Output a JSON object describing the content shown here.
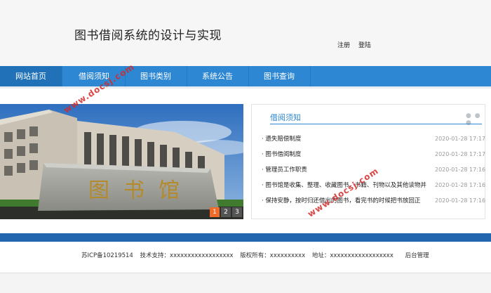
{
  "header": {
    "title": "图书借阅系统的设计与实现",
    "links": [
      "注册",
      "登陆"
    ]
  },
  "nav": {
    "items": [
      {
        "label": "网站首页",
        "active": true
      },
      {
        "label": "借阅须知",
        "active": false
      },
      {
        "label": "图书类别",
        "active": false
      },
      {
        "label": "系统公告",
        "active": false
      },
      {
        "label": "图书查询",
        "active": false
      }
    ]
  },
  "banner": {
    "pages": [
      "1",
      "2",
      "3"
    ],
    "active_page": 1,
    "stone_text": "图书馆"
  },
  "notice": {
    "title": "借阅须知",
    "more": "● ● ●",
    "items": [
      {
        "text": "· 遗失赔偿制度",
        "date": "2020-01-28 17:17"
      },
      {
        "text": "· 图书借阅制度",
        "date": "2020-01-28 17:17"
      },
      {
        "text": "· 管理员工作职责",
        "date": "2020-01-28 17:16"
      },
      {
        "text": "· 图书馆是收集、整理、收藏图书、书籍、刊物以及其他读物并",
        "date": "2020-01-28 17:16"
      },
      {
        "text": "· 保持安静，按时归还借出的图书，看完书的时候把书放回正",
        "date": "2020-01-28 17:16"
      }
    ]
  },
  "footer": {
    "icp": "苏ICP备10219514",
    "tech": "技术支持：xxxxxxxxxxxxxxxxxx",
    "copyright": "版权所有：xxxxxxxxxx",
    "address": "地址：xxxxxxxxxxxxxxxxxx",
    "admin": "后台管理"
  },
  "watermark": "www.docsj.com",
  "colors": {
    "nav": "#2d87d3",
    "nav_active": "#2171b8",
    "footer_bar": "#2366b0",
    "pager_active": "#f06a28"
  }
}
